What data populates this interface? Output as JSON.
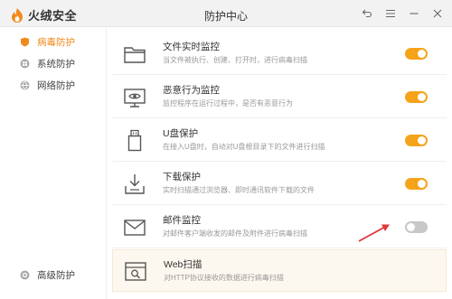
{
  "app": {
    "brand": "火绒安全",
    "window_title": "防护中心"
  },
  "sidebar": {
    "items": [
      {
        "label": "病毒防护",
        "icon": "shield-icon",
        "active": true
      },
      {
        "label": "系统防护",
        "icon": "windows-icon",
        "active": false
      },
      {
        "label": "网络防护",
        "icon": "globe-icon",
        "active": false
      }
    ],
    "bottom_item": {
      "label": "高级防护",
      "icon": "gear-icon"
    }
  },
  "protections": [
    {
      "title": "文件实时监控",
      "desc": "当文件被执行、创建、打开时，进行病毒扫描",
      "icon": "folder-icon",
      "enabled": true
    },
    {
      "title": "恶意行为监控",
      "desc": "监控程序在运行过程中，是否有恶意行为",
      "icon": "monitor-eye-icon",
      "enabled": true
    },
    {
      "title": "U盘保护",
      "desc": "在接入U盘时，自动对U盘根目录下的文件进行扫描",
      "icon": "usb-icon",
      "enabled": true
    },
    {
      "title": "下载保护",
      "desc": "实时扫描通过浏览器、即时通讯软件下载的文件",
      "icon": "download-icon",
      "enabled": true
    },
    {
      "title": "邮件监控",
      "desc": "对邮件客户端收发的邮件及附件进行病毒扫描",
      "icon": "mail-icon",
      "enabled": false
    },
    {
      "title": "Web扫描",
      "desc": "对HTTP协议接收的数据进行病毒扫描",
      "icon": "web-scan-icon",
      "enabled": null
    }
  ],
  "colors": {
    "accent": "#f08a1c",
    "toggle_on": "#f5a31a",
    "toggle_off": "#c8c8c8",
    "annotation_arrow": "#e0383e"
  }
}
